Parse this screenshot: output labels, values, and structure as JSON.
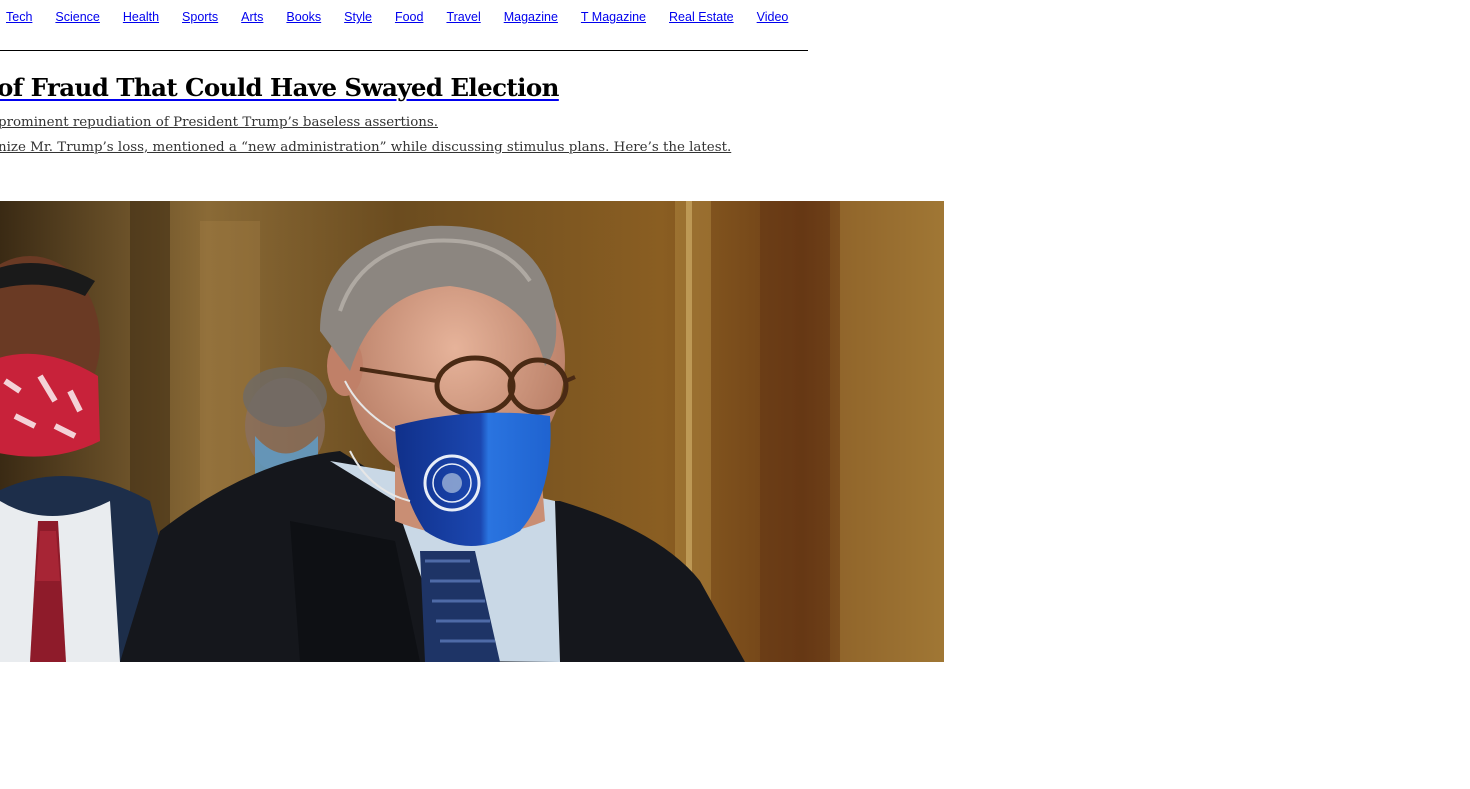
{
  "nav": {
    "items": [
      {
        "label": "Tech"
      },
      {
        "label": "Science"
      },
      {
        "label": "Health"
      },
      {
        "label": "Sports"
      },
      {
        "label": "Arts"
      },
      {
        "label": "Books"
      },
      {
        "label": "Style"
      },
      {
        "label": "Food"
      },
      {
        "label": "Travel"
      },
      {
        "label": "Magazine"
      },
      {
        "label": "T Magazine"
      },
      {
        "label": "Real Estate"
      },
      {
        "label": "Video"
      }
    ]
  },
  "story": {
    "headline": "of Fraud That Could Have Swayed Election",
    "summaries": [
      "prominent repudiation of President Trump’s baseless assertions.",
      "nize Mr. Trump’s loss, mentioned a “new administration” while discussing stimulus plans. Here’s the latest."
    ]
  },
  "photo": {
    "palette": {
      "wall": "#7a5523",
      "wall_light": "#a0782f",
      "suit": "#16181d",
      "shirt": "#c9d8e6",
      "mask_blue": "#1f5fc2",
      "mask_red": "#c8223a",
      "skin": "#d9a48a",
      "hair": "#8c8680"
    }
  }
}
